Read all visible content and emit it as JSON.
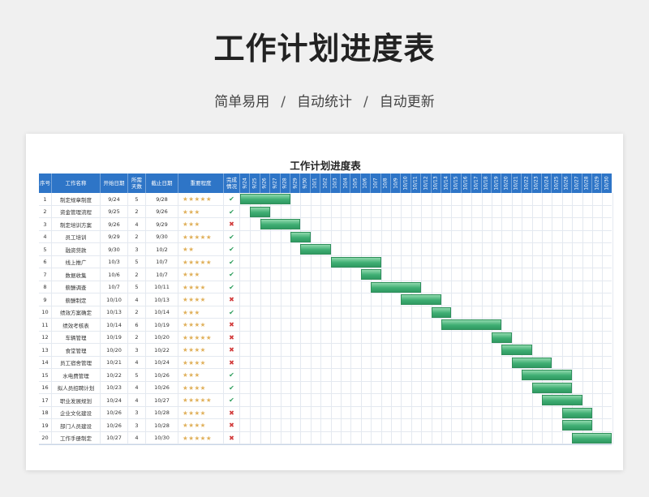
{
  "header": {
    "title": "工作计划进度表",
    "subtitle_parts": [
      "简单易用",
      "自动统计",
      "自动更新"
    ],
    "separator": "/"
  },
  "sheet": {
    "title": "工作计划进度表",
    "columns": {
      "index": "序号",
      "task": "工作名称",
      "start": "开始日期",
      "days": "所需天数",
      "end": "截止日期",
      "importance": "重要程度",
      "status": "完成情况"
    },
    "timeline_dates": [
      "9/24",
      "9/25",
      "9/26",
      "9/27",
      "9/28",
      "9/29",
      "9/30",
      "10/1",
      "10/2",
      "10/3",
      "10/4",
      "10/5",
      "10/6",
      "10/7",
      "10/8",
      "10/9",
      "10/10",
      "10/11",
      "10/12",
      "10/13",
      "10/14",
      "10/15",
      "10/16",
      "10/17",
      "10/18",
      "10/19",
      "10/20",
      "10/21",
      "10/22",
      "10/23",
      "10/24",
      "10/25",
      "10/26",
      "10/27",
      "10/28",
      "10/29",
      "10/30"
    ],
    "rows": [
      {
        "index": "1",
        "task": "制定规章制度",
        "start": "9/24",
        "days": "5",
        "end": "9/28",
        "stars": 5,
        "done": true,
        "offset": 0
      },
      {
        "index": "2",
        "task": "资金管理流程",
        "start": "9/25",
        "days": "2",
        "end": "9/26",
        "stars": 3,
        "done": true,
        "offset": 1
      },
      {
        "index": "3",
        "task": "制定培训方案",
        "start": "9/26",
        "days": "4",
        "end": "9/29",
        "stars": 3,
        "done": false,
        "offset": 2
      },
      {
        "index": "4",
        "task": "员工培训",
        "start": "9/29",
        "days": "2",
        "end": "9/30",
        "stars": 5,
        "done": true,
        "offset": 5
      },
      {
        "index": "5",
        "task": "融资贷款",
        "start": "9/30",
        "days": "3",
        "end": "10/2",
        "stars": 2,
        "done": true,
        "offset": 6
      },
      {
        "index": "6",
        "task": "线上推广",
        "start": "10/3",
        "days": "5",
        "end": "10/7",
        "stars": 5,
        "done": true,
        "offset": 9
      },
      {
        "index": "7",
        "task": "数据收集",
        "start": "10/6",
        "days": "2",
        "end": "10/7",
        "stars": 3,
        "done": true,
        "offset": 12
      },
      {
        "index": "8",
        "task": "薪酬调查",
        "start": "10/7",
        "days": "5",
        "end": "10/11",
        "stars": 4,
        "done": true,
        "offset": 13
      },
      {
        "index": "9",
        "task": "薪酬制定",
        "start": "10/10",
        "days": "4",
        "end": "10/13",
        "stars": 4,
        "done": false,
        "offset": 16
      },
      {
        "index": "10",
        "task": "绩效方案确定",
        "start": "10/13",
        "days": "2",
        "end": "10/14",
        "stars": 3,
        "done": true,
        "offset": 19
      },
      {
        "index": "11",
        "task": "绩效考核表",
        "start": "10/14",
        "days": "6",
        "end": "10/19",
        "stars": 4,
        "done": false,
        "offset": 20
      },
      {
        "index": "12",
        "task": "车辆管理",
        "start": "10/19",
        "days": "2",
        "end": "10/20",
        "stars": 5,
        "done": false,
        "offset": 25
      },
      {
        "index": "13",
        "task": "食堂管理",
        "start": "10/20",
        "days": "3",
        "end": "10/22",
        "stars": 4,
        "done": false,
        "offset": 26
      },
      {
        "index": "14",
        "task": "员工宿舍管理",
        "start": "10/21",
        "days": "4",
        "end": "10/24",
        "stars": 4,
        "done": false,
        "offset": 27
      },
      {
        "index": "15",
        "task": "水电费管理",
        "start": "10/22",
        "days": "5",
        "end": "10/26",
        "stars": 3,
        "done": true,
        "offset": 28
      },
      {
        "index": "16",
        "task": "拟人员招聘计划",
        "start": "10/23",
        "days": "4",
        "end": "10/26",
        "stars": 4,
        "done": true,
        "offset": 29
      },
      {
        "index": "17",
        "task": "职业发展规划",
        "start": "10/24",
        "days": "4",
        "end": "10/27",
        "stars": 5,
        "done": true,
        "offset": 30
      },
      {
        "index": "18",
        "task": "企业文化建设",
        "start": "10/26",
        "days": "3",
        "end": "10/28",
        "stars": 4,
        "done": false,
        "offset": 32
      },
      {
        "index": "19",
        "task": "部门人员建设",
        "start": "10/26",
        "days": "3",
        "end": "10/28",
        "stars": 4,
        "done": false,
        "offset": 32
      },
      {
        "index": "20",
        "task": "工作手册制定",
        "start": "10/27",
        "days": "4",
        "end": "10/30",
        "stars": 5,
        "done": false,
        "offset": 33
      }
    ],
    "colors": {
      "header": "#2e75c7",
      "bar": "#3fae73",
      "done": "#2f9e5e",
      "notdone": "#d23c3c",
      "star": "#e0b05a"
    },
    "icons": {
      "done": "check-icon",
      "notdone": "cross-icon",
      "importance": "star-icon"
    }
  }
}
